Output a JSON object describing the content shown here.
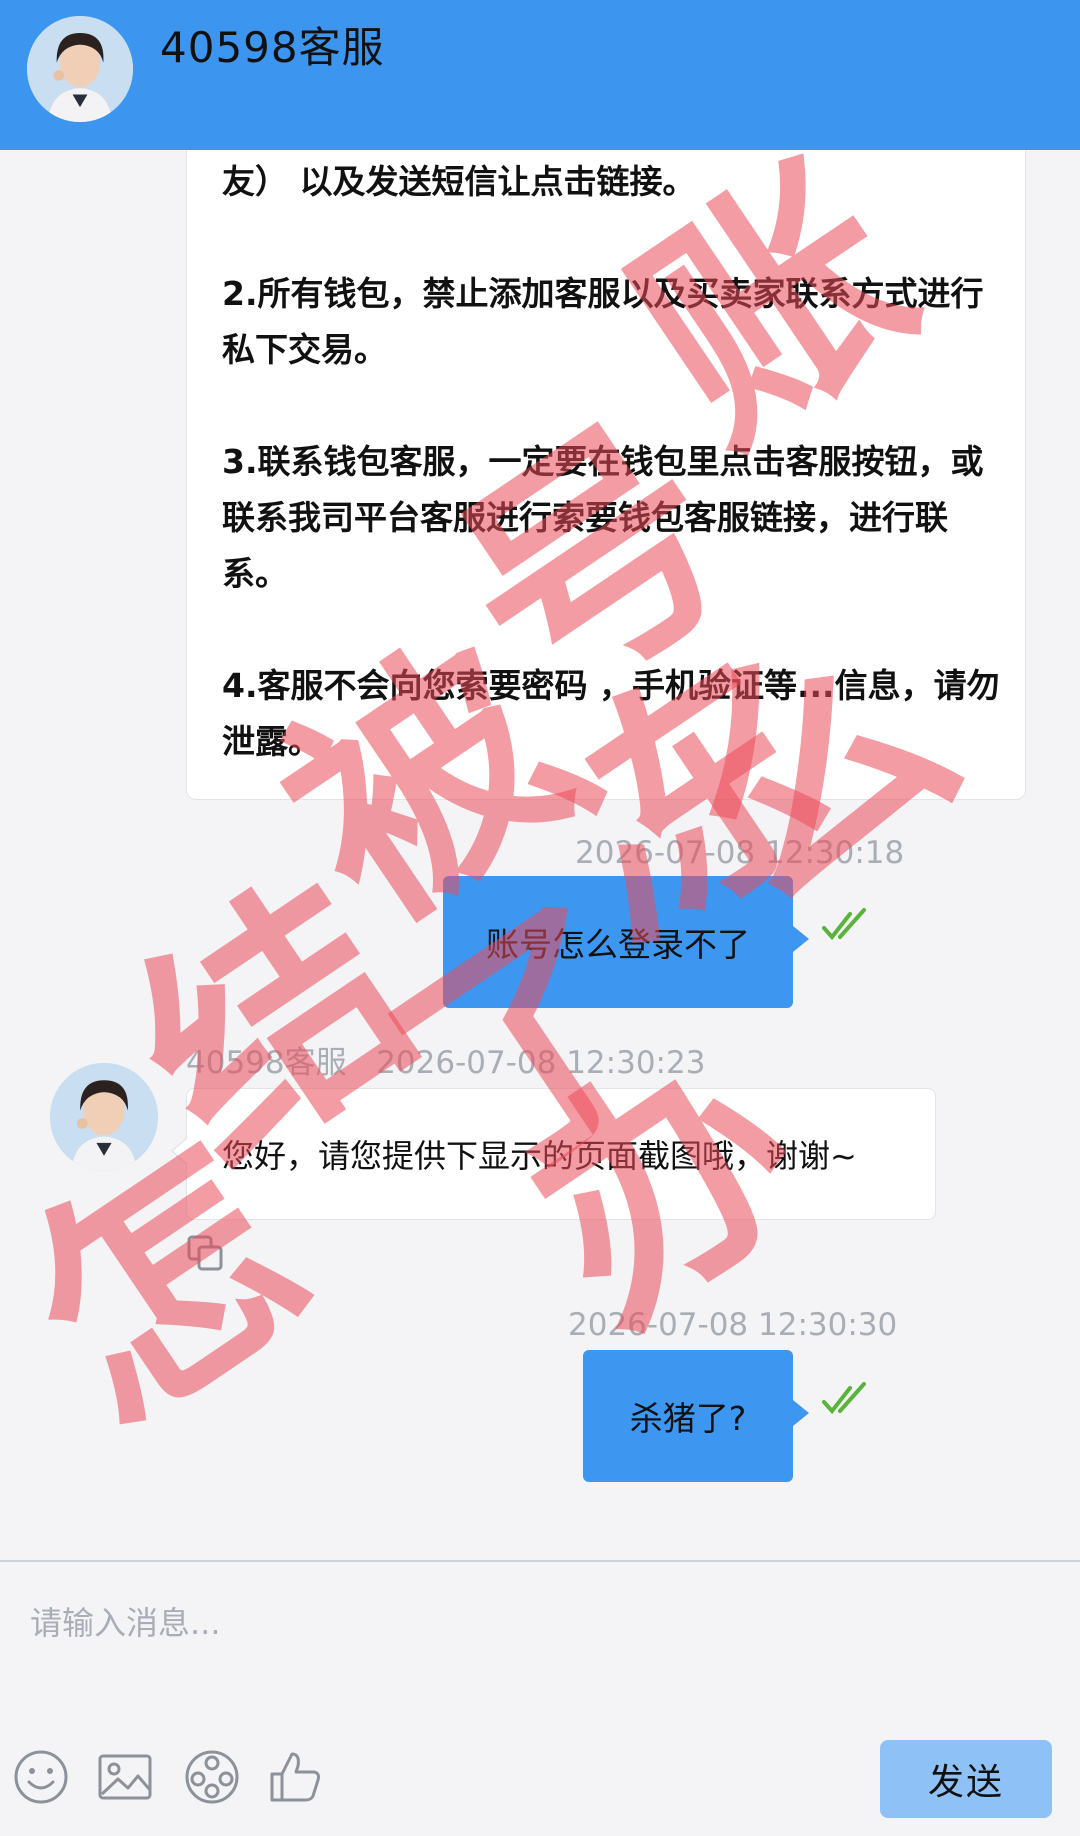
{
  "header": {
    "title": "40598客服",
    "avatar": "agent-avatar"
  },
  "messages": {
    "long_agent": {
      "line_1": "友） 以及发送短信让点击链接。",
      "para_2": "2.所有钱包，禁止添加客服以及买卖家联系方式进行私下交易。",
      "para_3": "3.联系钱包客服，一定要在钱包里点击客服按钮，或联系我司平台客服进行索要钱包客服链接，进行联系。",
      "para_4": "4.客服不会向您索要密码 ，手机验证等...信息，请勿泄露。"
    },
    "user_1": {
      "timestamp": "2026-07-08 12:30:18",
      "text": "账号怎么登录不了"
    },
    "agent_1": {
      "sender": "40598客服",
      "timestamp": "2026-07-08 12:30:23",
      "text": "您好，请您提供下显示的页面截图哦，谢谢~"
    },
    "user_2": {
      "timestamp": "2026-07-08 12:30:30",
      "text": "杀猪了?"
    }
  },
  "composer": {
    "placeholder": "请输入消息...",
    "send_label": "发送",
    "tools": [
      "emoji-icon",
      "image-icon",
      "video-icon",
      "thumbs-up-icon"
    ]
  },
  "watermark": {
    "chars": [
      "账",
      "号",
      "被",
      "冻",
      "结",
      "了",
      "怎",
      "么",
      "办"
    ]
  },
  "colors": {
    "header": "#3c95ef",
    "user_bubble": "#3d97f1",
    "send_button": "#8ec2f7",
    "read_check": "#5ab33c",
    "watermark": "#eb4b5a"
  }
}
